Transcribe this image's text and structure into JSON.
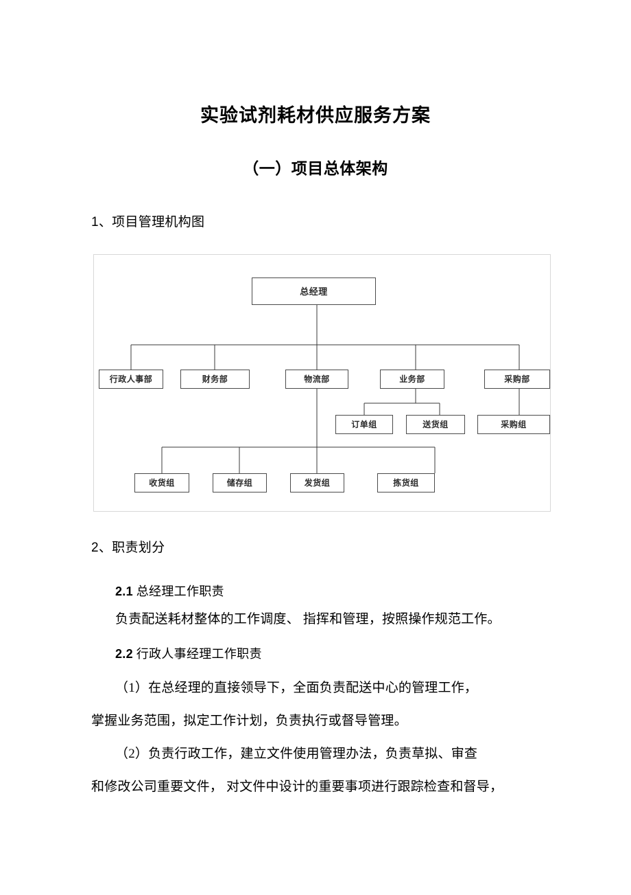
{
  "document": {
    "title": "实验试剂耗材供应服务方案",
    "section_title": "（一）项目总体架构",
    "heading_1": "1、项目管理机构图",
    "heading_2": "2、职责划分",
    "sub_headings": [
      {
        "num": "2.1",
        "text": "总经理工作职责"
      },
      {
        "num": "2.2",
        "text": "行政人事经理工作职责"
      }
    ],
    "paragraphs": [
      "负责配送耗材整体的工作调度、 指挥和管理，按照操作规范工作。",
      "（1）在总经理的直接领导下，全面负责配送中心的管理工作，",
      "掌握业务范围，拟定工作计划，负责执行或督导管理。",
      "（2）负责行政工作，建立文件使用管理办法，负责草拟、审查",
      "和修改公司重要文件， 对文件中设计的重要事项进行跟踪检查和督导，"
    ]
  },
  "org_chart": {
    "frame_border_color": "#d8d8d8",
    "node_border_color": "#4a4a4a",
    "connector_color": "#3a3a3a",
    "nodes": {
      "root": {
        "label": "总经理"
      },
      "departments": [
        {
          "label": "行政人事部"
        },
        {
          "label": "财务部"
        },
        {
          "label": "物流部"
        },
        {
          "label": "业务部"
        },
        {
          "label": "采购部"
        }
      ],
      "business_teams": [
        {
          "label": "订单组"
        },
        {
          "label": "送货组"
        }
      ],
      "purchasing_teams": [
        {
          "label": "采购组"
        }
      ],
      "logistics_teams": [
        {
          "label": "收货组"
        },
        {
          "label": "储存组"
        },
        {
          "label": "发货组"
        },
        {
          "label": "拣货组"
        }
      ]
    }
  }
}
